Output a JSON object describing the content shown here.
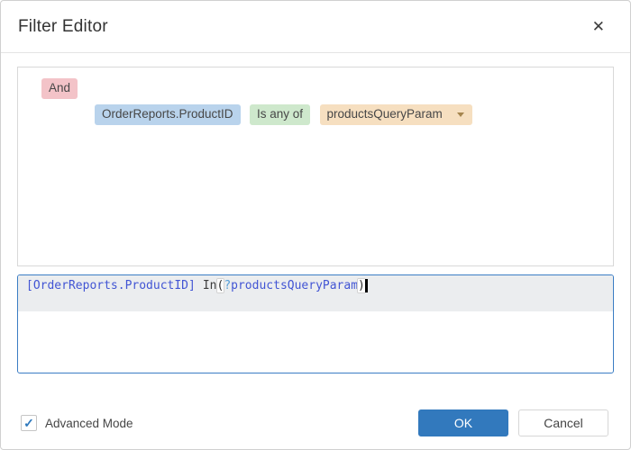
{
  "dialog": {
    "title": "Filter Editor"
  },
  "icons": {
    "close": "✕",
    "check": "✓",
    "dropdown": "chevron-down"
  },
  "filter_builder": {
    "group_operator": "And",
    "condition": {
      "field": "OrderReports.ProductID",
      "operator": "Is any of",
      "value": "productsQueryParam"
    }
  },
  "expression": {
    "field": "[OrderReports.ProductID]",
    "keyword": "In",
    "lparen": "(",
    "param_prefix": "?",
    "param_name": "productsQueryParam",
    "rparen": ")",
    "full_text": "[OrderReports.ProductID] In(?productsQueryParam)"
  },
  "footer": {
    "advanced_mode_label": "Advanced Mode",
    "advanced_mode_checked": true,
    "ok_label": "OK",
    "cancel_label": "Cancel"
  },
  "colors": {
    "accent_blue": "#3279bd",
    "editor_focus_border": "#3b7dc4",
    "chip_and_bg": "#f3c3c8",
    "chip_field_bg": "#b9d3ec",
    "chip_operator_bg": "#cee8cc",
    "chip_value_bg": "#f6dfc0",
    "syntax_field_blue": "#4255d4",
    "syntax_param_prefix_blue": "#58a0d8",
    "current_line_bg": "#ebedef"
  }
}
